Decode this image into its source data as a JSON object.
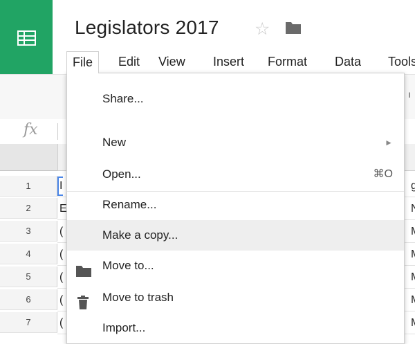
{
  "app": {
    "title": "Legislators 2017",
    "brand_color": "#21a464",
    "star_icon": "star-outline-icon",
    "folder_icon": "folder-icon"
  },
  "menubar": {
    "items": [
      "File",
      "Edit",
      "View",
      "Insert",
      "Format",
      "Data",
      "Tools"
    ],
    "active": "File"
  },
  "formula_bar": {
    "fx_label": "fx"
  },
  "grid": {
    "row_numbers": [
      "1",
      "2",
      "3",
      "4",
      "5",
      "6",
      "7"
    ],
    "left_clipped": [
      "I",
      "E",
      "(",
      "(",
      "(",
      "(",
      "("
    ],
    "right_clipped": [
      "g",
      "N",
      "M",
      "M",
      "M",
      "M",
      "M"
    ]
  },
  "file_menu": {
    "items": [
      {
        "label": "Share...",
        "shortcut": "",
        "submenu": false,
        "icon": ""
      },
      {
        "label": "New",
        "shortcut": "",
        "submenu": true,
        "icon": ""
      },
      {
        "label": "Open...",
        "shortcut": "⌘O",
        "submenu": false,
        "icon": ""
      },
      {
        "label": "Rename...",
        "shortcut": "",
        "submenu": false,
        "icon": ""
      },
      {
        "label": "Make a copy...",
        "shortcut": "",
        "submenu": false,
        "icon": "",
        "highlighted": true
      },
      {
        "label": "Move to...",
        "shortcut": "",
        "submenu": false,
        "icon": "folder-icon"
      },
      {
        "label": "Move to trash",
        "shortcut": "",
        "submenu": false,
        "icon": "trash-icon"
      },
      {
        "label": "Import...",
        "shortcut": "",
        "submenu": false,
        "icon": ""
      }
    ],
    "submenu_arrow": "►",
    "highlight_color": "#eeeeee"
  }
}
